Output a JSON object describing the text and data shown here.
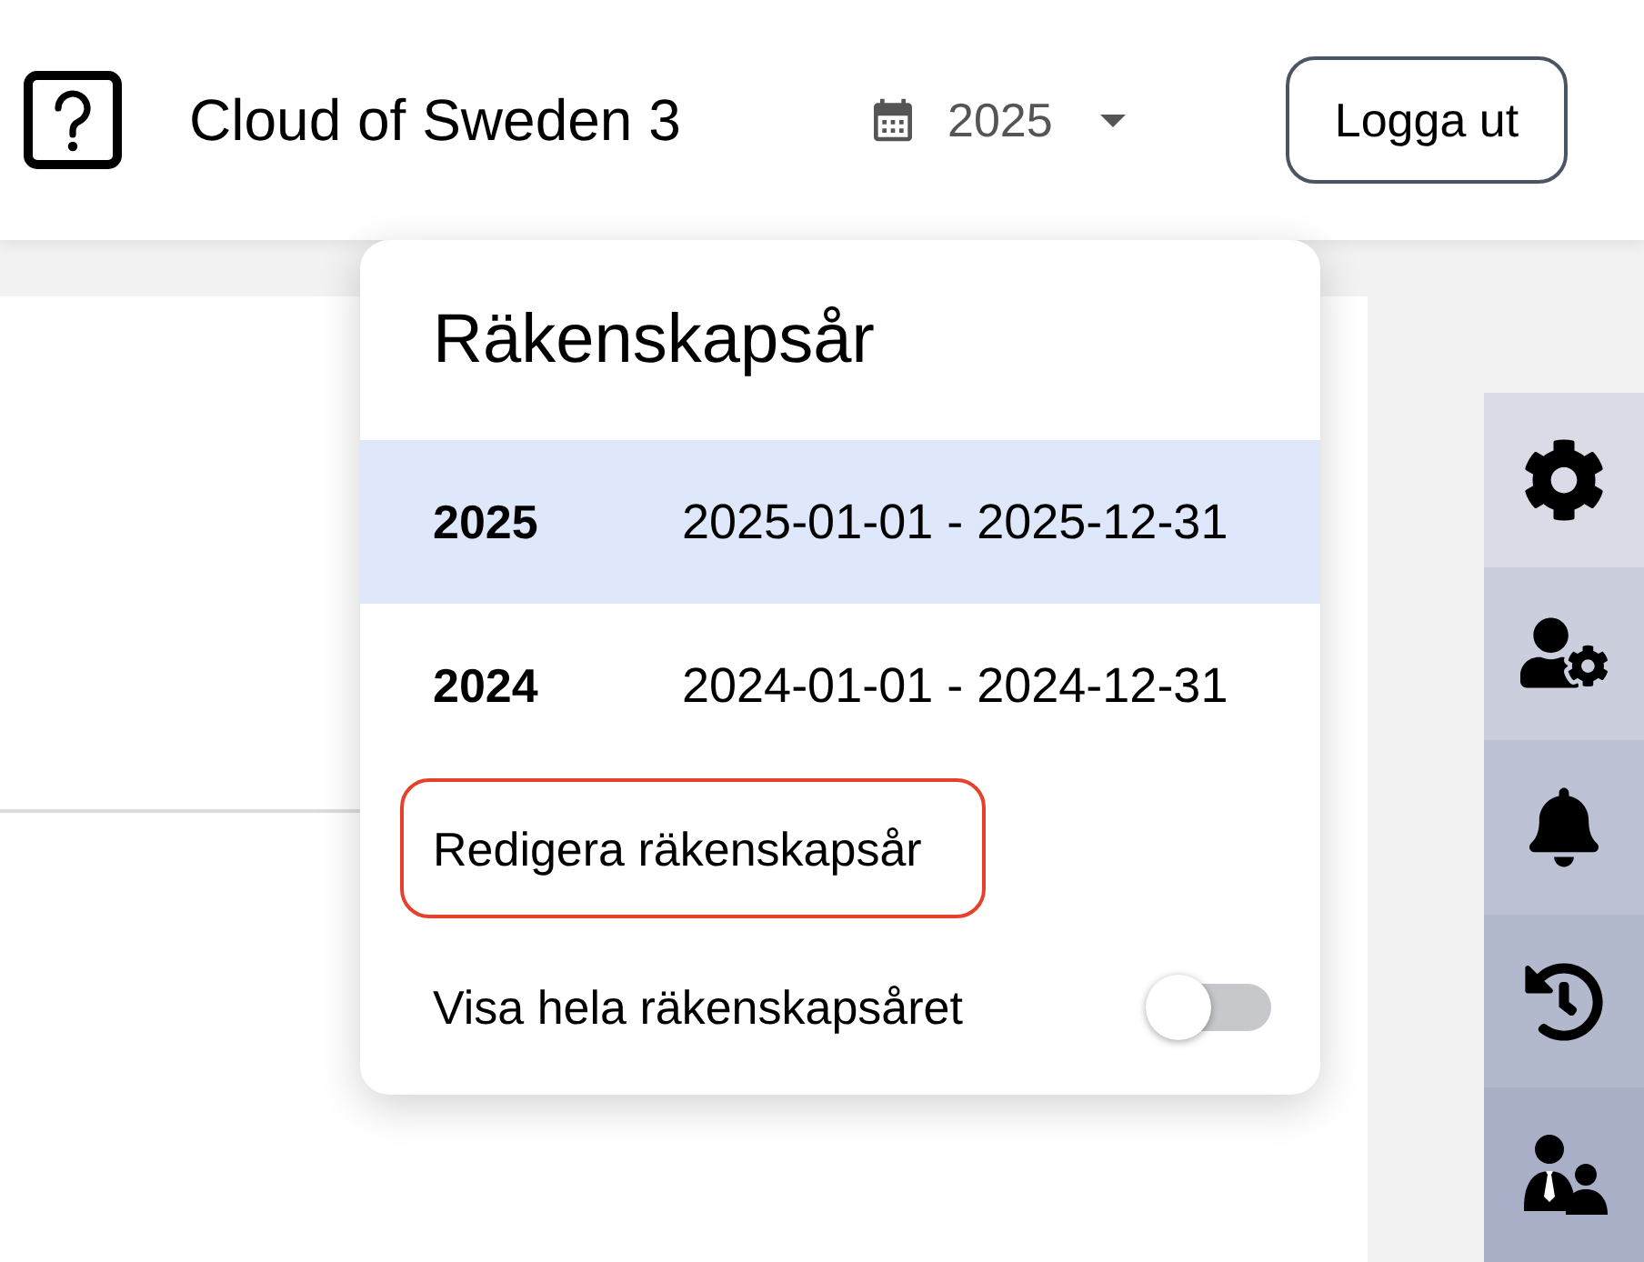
{
  "header": {
    "title": "Cloud of Sweden 3",
    "year_select": {
      "value": "2025",
      "expanded": true
    },
    "logout_button": "Logga ut"
  },
  "fiscal_year_menu": {
    "title": "Räkenskapsår",
    "years": [
      {
        "year": "2025",
        "range": "2025-01-01 - 2025-12-31",
        "selected": true
      },
      {
        "year": "2024",
        "range": "2024-01-01 - 2024-12-31",
        "selected": false
      }
    ],
    "edit_button": {
      "label": "Redigera räkenskapsår",
      "focused": true
    },
    "show_full_year": {
      "label": "Visa hela räkenskapsåret",
      "on": false
    }
  },
  "sidebar": {
    "items": [
      {
        "kind": "settings"
      },
      {
        "kind": "user_settings"
      },
      {
        "kind": "notifications"
      },
      {
        "kind": "history"
      },
      {
        "kind": "users"
      }
    ]
  }
}
